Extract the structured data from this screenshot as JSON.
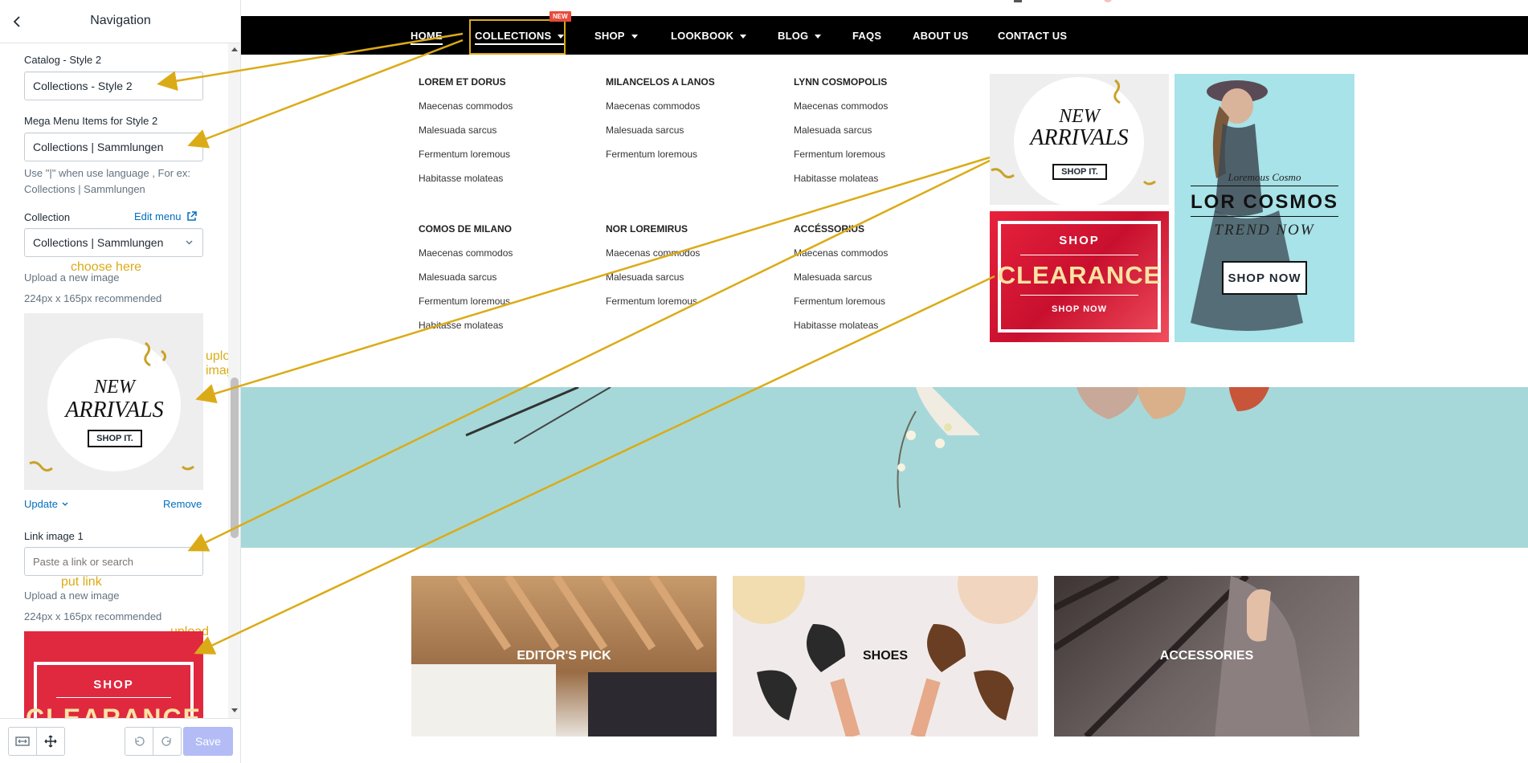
{
  "sidebar": {
    "title": "Navigation",
    "catalog_label": "Catalog - Style 2",
    "catalog_value": "Collections  - Style 2",
    "mega_label": "Mega Menu Items for Style 2",
    "mega_value": "Collections | Sammlungen",
    "mega_help": "Use \"|\" when use language , For ex: Collections | Sammlungen",
    "collection_label": "Collection",
    "edit_menu": "Edit menu",
    "collection_value": "Collections | Sammlungen",
    "upload_label": "Upload a new image",
    "upload_help": "224px x 165px recommended",
    "update": "Update",
    "remove": "Remove",
    "link_label": "Link image 1",
    "link_placeholder": "Paste a link or search",
    "upload_label_2": "Upload a new image",
    "upload_help_2": "224px x 165px recommended",
    "save": "Save"
  },
  "annotations": {
    "choose": "choose here",
    "upload1": "upload image",
    "put_link": "put link",
    "upload2": "upload image"
  },
  "nav": {
    "items": [
      "HOME",
      "COLLECTIONS",
      "SHOP",
      "LOOKBOOK",
      "BLOG",
      "FAQS",
      "ABOUT US",
      "CONTACT US"
    ],
    "badge": "NEW"
  },
  "megamenu": {
    "columns": [
      {
        "title": "LOREM ET DORUS",
        "links": [
          "Maecenas commodos",
          "Malesuada sarcus",
          "Fermentum loremous",
          "Habitasse molateas"
        ]
      },
      {
        "title": "MILANCELOS A LANOS",
        "links": [
          "Maecenas commodos",
          "Malesuada sarcus",
          "Fermentum loremous"
        ]
      },
      {
        "title": "LYNN COSMOPOLIS",
        "links": [
          "Maecenas commodos",
          "Malesuada sarcus",
          "Fermentum loremous",
          "Habitasse molateas"
        ]
      },
      {
        "title": "COMOS DE MILANO",
        "links": [
          "Maecenas commodos",
          "Malesuada sarcus",
          "Fermentum loremous",
          "Habitasse molateas"
        ]
      },
      {
        "title": "NOR LOREMIRUS",
        "links": [
          "Maecenas commodos",
          "Malesuada sarcus",
          "Fermentum loremous"
        ]
      },
      {
        "title": "ACCÉSSORIUS",
        "links": [
          "Maecenas commodos",
          "Malesuada sarcus",
          "Fermentum loremous",
          "Habitasse molateas"
        ]
      }
    ]
  },
  "banners": {
    "new_arrivals": {
      "line1": "NEW",
      "line2": "ARRIVALS",
      "cta": "SHOP IT."
    },
    "clearance": {
      "top": "SHOP",
      "main": "CLEARANCE",
      "cta": "SHOP NOW"
    },
    "cosmos": {
      "script": "Loremous Cosmo",
      "title": "LOR COSMOS",
      "sub": "TREND NOW",
      "cta": "SHOP NOW"
    }
  },
  "tiles": [
    "EDITOR'S PICK",
    "SHOES",
    "ACCESSORIES"
  ],
  "colors": {
    "accent_annotation": "#dbab17",
    "link_blue": "#006fbb",
    "save_disabled": "#b3bcf5",
    "hero_bg": "#a6d8d9",
    "badge_red": "#e74c3c"
  }
}
